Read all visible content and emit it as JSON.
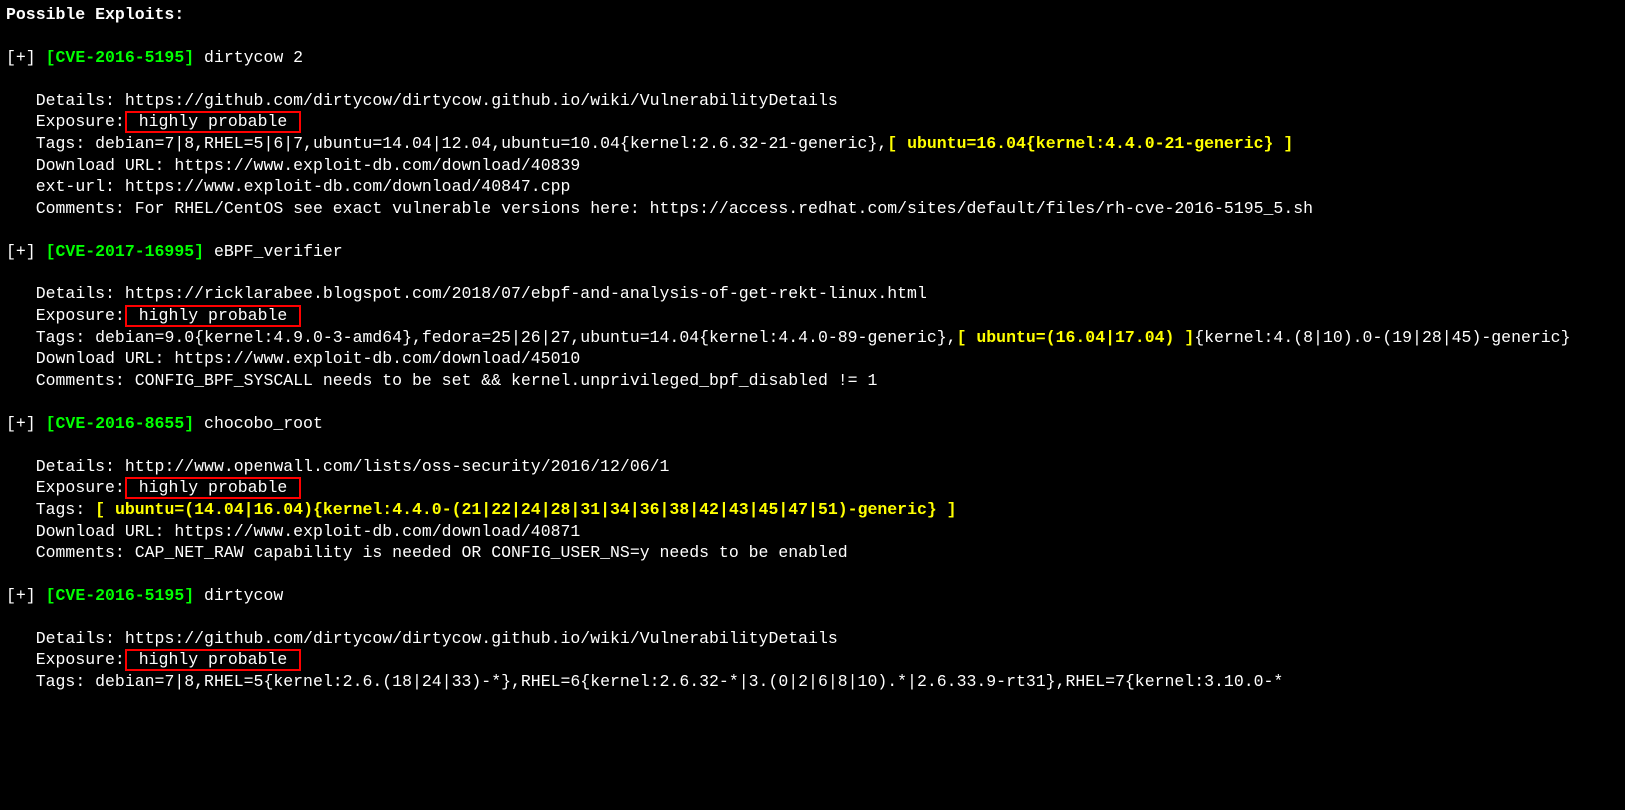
{
  "heading": "Possible Exploits:",
  "exploits": [
    {
      "prefix": "[+]",
      "cve": "[CVE-2016-5195]",
      "name": "dirtycow 2",
      "indent": "   ",
      "details_label": "Details: ",
      "details_pre": "",
      "details_post": "https://github.com/dirtycow/dirtycow.github.io/wiki/VulnerabilityDetails",
      "exposure_label": "Exposure:",
      "exposure_value": " highly probable ",
      "tags_label": "Tags: ",
      "tags_pre": "debian=7|8,RHEL=5|6|7,ubuntu=14.04|12.04,ubuntu=10.04{kernel:2.6.32-21-generic},",
      "tags_highlight": "[ ubuntu=16.04{kernel:4.4.0-21-generic} ]",
      "tags_post": "",
      "extras": [
        "Download URL: https://www.exploit-db.com/download/40839",
        "ext-url: https://www.exploit-db.com/download/40847.cpp",
        "Comments: For RHEL/CentOS see exact vulnerable versions here: https://access.redhat.com/sites/default/files/rh-cve-2016-5195_5.sh"
      ]
    },
    {
      "prefix": "[+]",
      "cve": "[CVE-2017-16995]",
      "name": "eBPF_verifier",
      "indent": "   ",
      "details_label": "Details: ",
      "details_pre": "",
      "details_post": "https://ricklarabee.blogspot.com/2018/07/ebpf-and-analysis-of-get-rekt-linux.html",
      "exposure_label": "Exposure:",
      "exposure_value": " highly probable ",
      "tags_label": "Tags: ",
      "tags_pre": "debian=9.0{kernel:4.9.0-3-amd64},fedora=25|26|27,ubuntu=14.04{kernel:4.4.0-89-generic},",
      "tags_highlight": "[ ubuntu=(16.04|17.04) ]",
      "tags_post": "{kernel:4.(8|10).0-(19|28|45)-generic}",
      "extras": [
        "Download URL: https://www.exploit-db.com/download/45010",
        "Comments: CONFIG_BPF_SYSCALL needs to be set && kernel.unprivileged_bpf_disabled != 1"
      ]
    },
    {
      "prefix": "[+]",
      "cve": "[CVE-2016-8655]",
      "name": "chocobo_root",
      "indent": "   ",
      "details_label": "Details: ",
      "details_pre": "",
      "details_post": "http://www.openwall.com/lists/oss-security/2016/12/06/1",
      "exposure_label": "Exposure:",
      "exposure_value": " highly probable ",
      "tags_label": "Tags: ",
      "tags_pre": "",
      "tags_highlight": "[ ubuntu=(14.04|16.04){kernel:4.4.0-(21|22|24|28|31|34|36|38|42|43|45|47|51)-generic} ]",
      "tags_post": "",
      "extras": [
        "Download URL: https://www.exploit-db.com/download/40871",
        "Comments: CAP_NET_RAW capability is needed OR CONFIG_USER_NS=y needs to be enabled"
      ]
    },
    {
      "prefix": "[+]",
      "cve": "[CVE-2016-5195]",
      "name": "dirtycow",
      "indent": "   ",
      "details_label": "Details: ",
      "details_pre": "",
      "details_post": "https://github.com/dirtycow/dirtycow.github.io/wiki/VulnerabilityDetails",
      "exposure_label": "Exposure:",
      "exposure_value": " highly probable ",
      "tags_label": "Tags: ",
      "tags_pre": "debian=7|8,RHEL=5{kernel:2.6.(18|24|33)-*},RHEL=6{kernel:2.6.32-*|3.(0|2|6|8|10).*|2.6.33.9-rt31},RHEL=7{kernel:3.10.0-*",
      "tags_highlight": "",
      "tags_post": "",
      "extras": []
    }
  ]
}
